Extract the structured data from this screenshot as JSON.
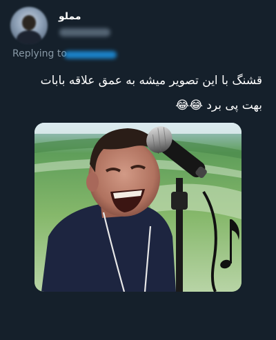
{
  "tweet": {
    "author_name": "مملو",
    "replying_label": "Replying to",
    "text_line_1": "قشنگ با این تصویر میشه به عمق علاقه بابات",
    "text_line_2": "بهت پی برد 😂😂"
  },
  "media": {
    "icon": "laughing-man-microphone-image"
  },
  "colors": {
    "background": "#15202b",
    "secondary_text": "#8899a6",
    "accent": "#1d9bf0"
  }
}
